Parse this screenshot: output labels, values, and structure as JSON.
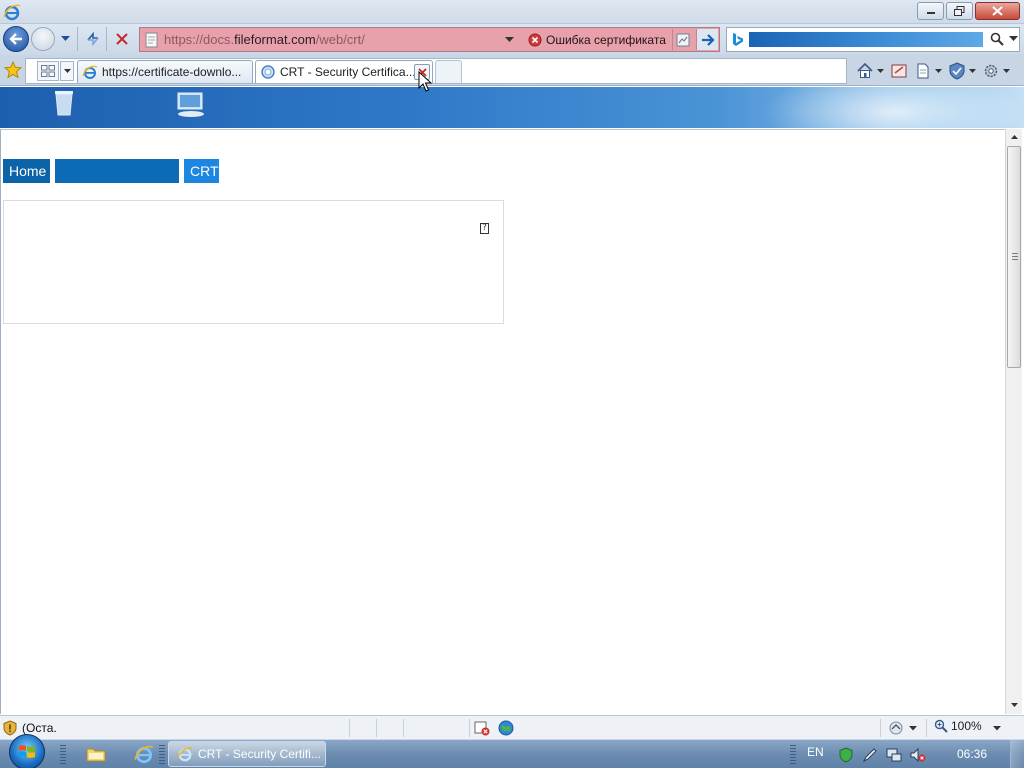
{
  "window": {
    "title": "",
    "buttons": [
      "minimize",
      "maximize",
      "close"
    ]
  },
  "navigation": {
    "address_url_prefix": "https://docs.",
    "address_url_host": "fileformat.com",
    "address_url_path": "/web/crt/",
    "certificate_error_label": "Ошибка сертификата",
    "search_value": ""
  },
  "tabs": [
    {
      "title": "https://certificate-downlo...",
      "active": false
    },
    {
      "title": "CRT - Security Certifica...",
      "active": true
    }
  ],
  "page": {
    "breadcrumbs": [
      {
        "label": "Home"
      },
      {
        "label": ""
      },
      {
        "label": "CRT"
      }
    ],
    "card_glyph": "?"
  },
  "statusbar": {
    "text": "(Оста.",
    "zoom": "100%"
  },
  "taskbar": {
    "task_title": "CRT - Security Certifi...",
    "language": "EN",
    "clock": "06:36"
  },
  "colors": {
    "breadcrumb_home": "#0b63a8",
    "breadcrumb_mid": "#0d6bb6",
    "breadcrumb_crt": "#1c86e0",
    "address_error_bg": "#e8a1ab",
    "search_highlight": "#1a64b6"
  },
  "icons": {
    "back": "back-arrow-icon",
    "forward": "forward-arrow-icon",
    "refresh": "compatibility-refresh-icon",
    "stop": "stop-icon",
    "certificate_error": "certificate-error-icon",
    "go": "go-arrow-icon",
    "bing": "bing-icon",
    "search": "magnifier-icon",
    "favorites": "star-icon",
    "home": "home-icon",
    "feeds": "feeds-icon",
    "page": "page-icon",
    "safety": "safety-icon",
    "tools": "gear-icon"
  }
}
